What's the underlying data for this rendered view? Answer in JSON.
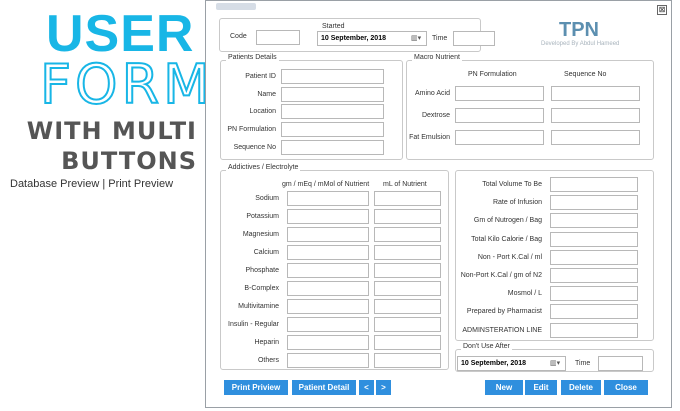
{
  "promo": {
    "title_line1": "USER",
    "title_line2": "FORM",
    "subtitle_line1": "WITH MULTI",
    "subtitle_line2": "BUTTONS",
    "preview_links": "Database Preview | Print Preview"
  },
  "window": {
    "close_glyph": "⊠",
    "brand": "TPN",
    "developer": "Developed By Abdul Hameed"
  },
  "header": {
    "code_label": "Code",
    "code_value": "",
    "started_legend": "Started",
    "started_date": "10 September, 2018",
    "time_label": "Time",
    "time_value": ""
  },
  "patient_details": {
    "legend": "Patients Details",
    "fields": [
      {
        "label": "Patient ID",
        "value": ""
      },
      {
        "label": "Name",
        "value": ""
      },
      {
        "label": "Location",
        "value": ""
      },
      {
        "label": "PN Formulation",
        "value": ""
      },
      {
        "label": "Sequence No",
        "value": ""
      }
    ]
  },
  "macro_nutrient": {
    "legend": "Macro Nutrient",
    "col1_header": "PN Formulation",
    "col2_header": "Sequence No",
    "rows": [
      {
        "label": "Amino Acid",
        "formulation": "",
        "sequence": ""
      },
      {
        "label": "Dextrose",
        "formulation": "",
        "sequence": ""
      },
      {
        "label": "Fat Emulsion",
        "formulation": "",
        "sequence": ""
      }
    ]
  },
  "additives": {
    "legend": "Addictives / Electrolyte",
    "col1_header": "gm / mEq / mMol of Nutrient",
    "col2_header": "mL of Nutrient",
    "rows": [
      {
        "label": "Sodium",
        "amount": "",
        "ml": ""
      },
      {
        "label": "Potassium",
        "amount": "",
        "ml": ""
      },
      {
        "label": "Magnesium",
        "amount": "",
        "ml": ""
      },
      {
        "label": "Calcium",
        "amount": "",
        "ml": ""
      },
      {
        "label": "Phosphate",
        "amount": "",
        "ml": ""
      },
      {
        "label": "B-Complex",
        "amount": "",
        "ml": ""
      },
      {
        "label": "Multivitamine",
        "amount": "",
        "ml": ""
      },
      {
        "label": "Insulin - Regular",
        "amount": "",
        "ml": ""
      },
      {
        "label": "Heparin",
        "amount": "",
        "ml": ""
      },
      {
        "label": "Others",
        "amount": "",
        "ml": ""
      }
    ]
  },
  "totals": {
    "rows": [
      {
        "label": "Total Volume To Be",
        "value": ""
      },
      {
        "label": "Rate of Infusion",
        "value": ""
      },
      {
        "label": "Gm of Nutrogen / Bag",
        "value": ""
      },
      {
        "label": "Total Kilo Calorie /  Bag",
        "value": ""
      },
      {
        "label": "Non - Port K.Cal / ml",
        "value": ""
      },
      {
        "label": "Non-Port K.Cal / gm of N2",
        "value": ""
      },
      {
        "label": "Mosmol / L",
        "value": ""
      },
      {
        "label": "Prepared by Pharmacist",
        "value": ""
      },
      {
        "label": "ADMINSTERATION LINE",
        "value": ""
      }
    ]
  },
  "dont_use": {
    "legend": "Don't Use After",
    "date": "10 September, 2018",
    "time_label": "Time",
    "time_value": ""
  },
  "buttons": {
    "print_preview": "Print Priview",
    "patient_detail": "Patient Detail",
    "prev": "<",
    "next": ">",
    "new": "New",
    "edit": "Edit",
    "delete": "Delete",
    "close": "Close"
  },
  "colors": {
    "accent": "#18b6e6",
    "button": "#2f8fde",
    "brand": "#5c8fb0"
  }
}
